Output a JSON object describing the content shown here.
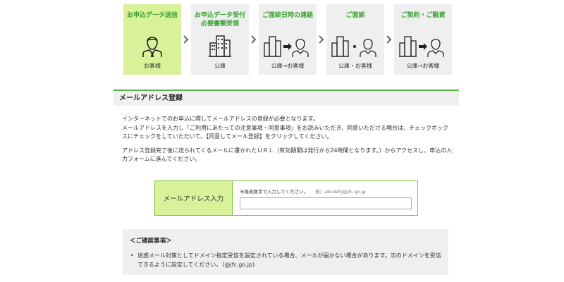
{
  "steps": [
    {
      "title": "お申込データ送信",
      "actor": "お客様",
      "icon": "customer-icon"
    },
    {
      "title": "お申込データ受付\n必要書類受領",
      "actor": "公庫",
      "icon": "building-icon"
    },
    {
      "title": "ご面談日時の連絡",
      "actor": "公庫→お客様",
      "icon": "building-to-customer-icon"
    },
    {
      "title": "ご面談",
      "actor": "公庫・お客様",
      "icon": "building-and-customer-icon"
    },
    {
      "title": "ご契約・ご融資",
      "actor": "公庫→お客様",
      "icon": "building-to-customer-icon"
    }
  ],
  "colors": {
    "accent_green": "#3aa232",
    "active_step_bg": "#d9f199",
    "border_green": "#7cc13a"
  },
  "section": {
    "title": "メールアドレス登録"
  },
  "intro": {
    "line1": "インターネットでのお申込に際してメールアドレスの登録が必要となります。",
    "line2": "メールアドレスを入力し「ご利用にあたっての注意事項・同意事項」をお読みいただき、同意いただける場合は、チェックボックスにチェックをしていただいて、【同意してメール登録】をクリックしてください。",
    "line3": "アドレス登録完了後に送られてくるメールに書かれたＵＲＬ（有効期間は発行から24時間となります。）からアクセスし、申込の入力フォームに進んでください。"
  },
  "email": {
    "label": "メールアドレス入力",
    "hint": "半角英数字で入力してください。",
    "example": "例）abcdefg@jfc.go.jp",
    "value": "",
    "placeholder": ""
  },
  "confirm": {
    "title": "＜ご確認事項＞",
    "items": [
      "迷惑メール対策としてドメイン指定受信を設定されている場合、メールが届かない場合があります。次のドメインを受信できるように設定してください。（@jfc.go.jp)"
    ]
  }
}
